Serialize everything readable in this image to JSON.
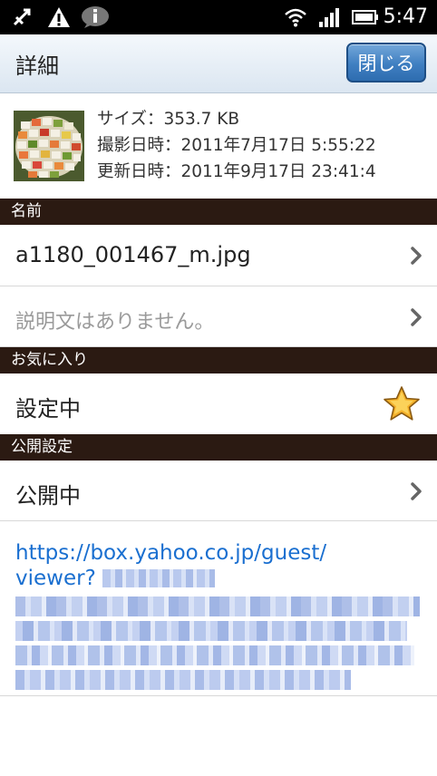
{
  "status_bar": {
    "time": "5:47",
    "left_icons": [
      "usb-debug-icon",
      "warning-icon",
      "info-icon"
    ],
    "right_icons": [
      "wifi-icon",
      "signal-icon",
      "battery-icon"
    ]
  },
  "title_bar": {
    "title": "詳細",
    "close_label": "閉じる"
  },
  "file_info": {
    "size": "サイズ：353.7 KB",
    "taken": "撮影日時：2011年7月17日 5:55:22",
    "updated": "更新日時：2011年9月17日 23:41:4"
  },
  "sections": {
    "name_header": "名前",
    "favorite_header": "お気に入り",
    "public_header": "公開設定"
  },
  "rows": {
    "filename": "a1180_001467_m.jpg",
    "description": "説明文はありません。",
    "favorite_state": "設定中",
    "public_state": "公開中"
  },
  "share_url": {
    "line1": "https://box.yahoo.co.jp/guest/",
    "line2": "viewer?"
  },
  "colors": {
    "section_header_bg": "#2b1a12",
    "link": "#1a6fd0",
    "button": "#3f7fc1",
    "star": "#f2a81d"
  }
}
